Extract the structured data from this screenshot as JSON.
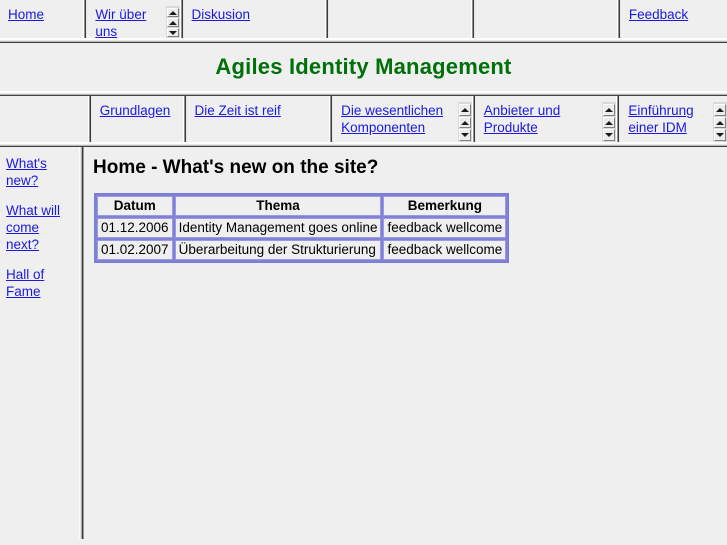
{
  "site": {
    "title": "Agiles Identity Management",
    "title_color": "#00700a",
    "link_color": "#1a1ae0",
    "background": "#efefef"
  },
  "top_nav": {
    "items": [
      {
        "label": "Home",
        "has_scroll": false
      },
      {
        "label": "Wir über uns",
        "has_scroll": true
      },
      {
        "label": "Diskusion",
        "has_scroll": false
      },
      {
        "label": "",
        "has_scroll": false
      },
      {
        "label": "",
        "has_scroll": false
      },
      {
        "label": "Feedback",
        "has_scroll": false
      }
    ]
  },
  "sub_nav": {
    "items": [
      {
        "label": "",
        "has_scroll": false
      },
      {
        "label": "Grundlagen",
        "has_scroll": false
      },
      {
        "label": "Die Zeit ist reif",
        "has_scroll": false
      },
      {
        "label": "Die wesentlichen Komponenten",
        "has_scroll": true
      },
      {
        "label": "Anbieter und Produkte",
        "has_scroll": true
      },
      {
        "label": "Einführung einer IDM",
        "has_scroll": true
      }
    ]
  },
  "sidebar": {
    "items": [
      {
        "label": "What's new?"
      },
      {
        "label": "What will come next?"
      },
      {
        "label": "Hall of Fame"
      }
    ]
  },
  "main": {
    "heading": "Home - What's new on the site?",
    "table": {
      "headers": [
        "Datum",
        "Thema",
        "Bemerkung"
      ],
      "rows": [
        {
          "datum": "01.12.2006",
          "thema": "Identity Management goes online",
          "bemerkung": "feedback wellcome"
        },
        {
          "datum": "01.02.2007",
          "thema": "Überarbeitung der Strukturierung",
          "bemerkung": "feedback wellcome"
        }
      ]
    }
  },
  "icons": {
    "scroll_up": "triangle-up-icon",
    "scroll_down": "triangle-down-icon"
  }
}
